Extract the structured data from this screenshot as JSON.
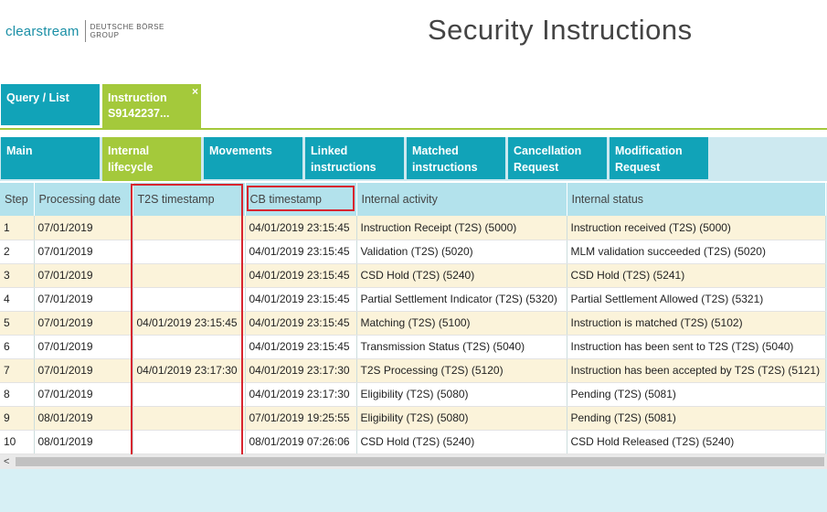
{
  "logo": {
    "word": "clearstream",
    "group_line1": "DEUTSCHE BÖRSE",
    "group_line2": "GROUP"
  },
  "page": {
    "title": "Security Instructions"
  },
  "top_tabs": {
    "query": {
      "label": "Query / List"
    },
    "instruction": {
      "line1": "Instruction",
      "line2": "S9142237...",
      "close": "×"
    }
  },
  "sub_tabs": [
    {
      "line1": "Main",
      "line2": ""
    },
    {
      "line1": "Internal lifecycle",
      "line2": ""
    },
    {
      "line1": "Movements",
      "line2": ""
    },
    {
      "line1": "Linked",
      "line2": "instructions"
    },
    {
      "line1": "Matched",
      "line2": "instructions"
    },
    {
      "line1": "Cancellation",
      "line2": "Request"
    },
    {
      "line1": "Modification",
      "line2": "Request"
    }
  ],
  "columns": [
    "Step",
    "Processing date",
    "T2S timestamp",
    "CB timestamp",
    "Internal activity",
    "Internal status"
  ],
  "rows": [
    {
      "step": "1",
      "processing_date": "07/01/2019",
      "t2s_timestamp": "",
      "cb_timestamp": "04/01/2019 23:15:45",
      "internal_activity": "Instruction Receipt (T2S) (5000)",
      "internal_status": "Instruction received (T2S) (5000)"
    },
    {
      "step": "2",
      "processing_date": "07/01/2019",
      "t2s_timestamp": "",
      "cb_timestamp": "04/01/2019 23:15:45",
      "internal_activity": "Validation (T2S) (5020)",
      "internal_status": "MLM validation succeeded (T2S) (5020)"
    },
    {
      "step": "3",
      "processing_date": "07/01/2019",
      "t2s_timestamp": "",
      "cb_timestamp": "04/01/2019 23:15:45",
      "internal_activity": "CSD Hold (T2S) (5240)",
      "internal_status": "CSD Hold (T2S) (5241)"
    },
    {
      "step": "4",
      "processing_date": "07/01/2019",
      "t2s_timestamp": "",
      "cb_timestamp": "04/01/2019 23:15:45",
      "internal_activity": "Partial Settlement Indicator (T2S) (5320)",
      "internal_status": "Partial Settlement Allowed (T2S) (5321)"
    },
    {
      "step": "5",
      "processing_date": "07/01/2019",
      "t2s_timestamp": "04/01/2019 23:15:45",
      "cb_timestamp": "04/01/2019 23:15:45",
      "internal_activity": "Matching (T2S) (5100)",
      "internal_status": "Instruction is matched (T2S) (5102)"
    },
    {
      "step": "6",
      "processing_date": "07/01/2019",
      "t2s_timestamp": "",
      "cb_timestamp": "04/01/2019 23:15:45",
      "internal_activity": "Transmission Status (T2S) (5040)",
      "internal_status": "Instruction has been sent to T2S (T2S) (5040)"
    },
    {
      "step": "7",
      "processing_date": "07/01/2019",
      "t2s_timestamp": "04/01/2019 23:17:30",
      "cb_timestamp": "04/01/2019 23:17:30",
      "internal_activity": "T2S Processing (T2S) (5120)",
      "internal_status": "Instruction has been accepted by T2S (T2S) (5121)"
    },
    {
      "step": "8",
      "processing_date": "07/01/2019",
      "t2s_timestamp": "",
      "cb_timestamp": "04/01/2019 23:17:30",
      "internal_activity": "Eligibility (T2S) (5080)",
      "internal_status": "Pending (T2S) (5081)"
    },
    {
      "step": "9",
      "processing_date": "08/01/2019",
      "t2s_timestamp": "",
      "cb_timestamp": "07/01/2019 19:25:55",
      "internal_activity": "Eligibility (T2S) (5080)",
      "internal_status": "Pending (T2S) (5081)"
    },
    {
      "step": "10",
      "processing_date": "08/01/2019",
      "t2s_timestamp": "",
      "cb_timestamp": "08/01/2019 07:26:06",
      "internal_activity": "CSD Hold (T2S) (5240)",
      "internal_status": "CSD Hold Released (T2S) (5240)"
    }
  ],
  "scrollbar": {
    "left_arrow": "<"
  },
  "colors": {
    "teal": "#11a3b8",
    "green": "#a4c93b",
    "highlight": "#d7252f",
    "header_bg": "#b3e2ec",
    "row_alt": "#fbf3da"
  }
}
